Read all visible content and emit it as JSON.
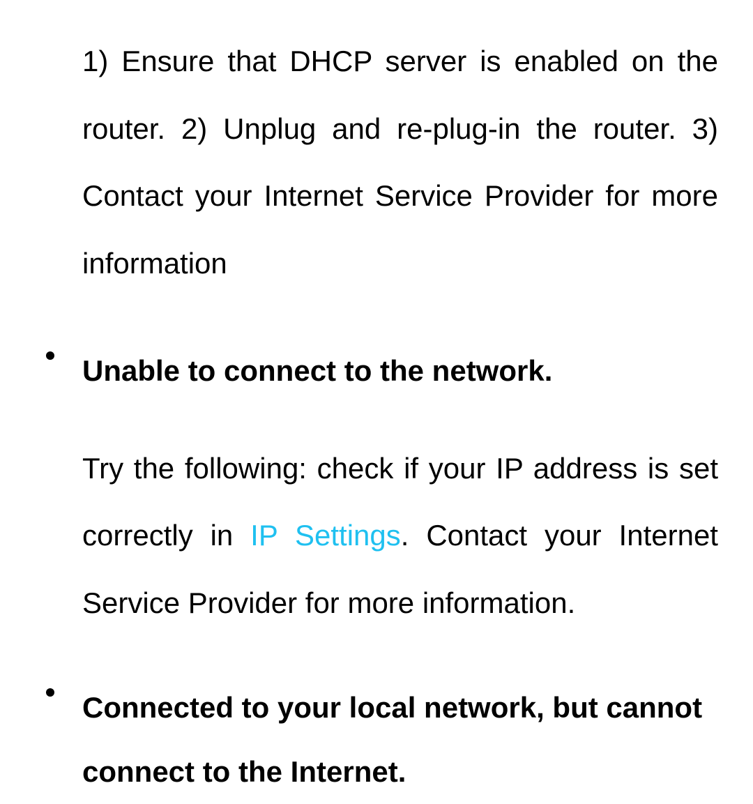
{
  "intro_paragraph": "1) Ensure that DHCP server is enabled on the router. 2) Unplug and re-plug-in the router. 3) Contact your Internet Service Provider for more information",
  "items": [
    {
      "heading": "Unable to connect to the network.",
      "body_prefix": "Try the following: check if your IP address is set correctly in ",
      "link_text": "IP Settings",
      "body_suffix": ". Contact your Internet Service Provider for more information."
    },
    {
      "heading": "Connected to your local network, but cannot connect to the Internet."
    }
  ]
}
